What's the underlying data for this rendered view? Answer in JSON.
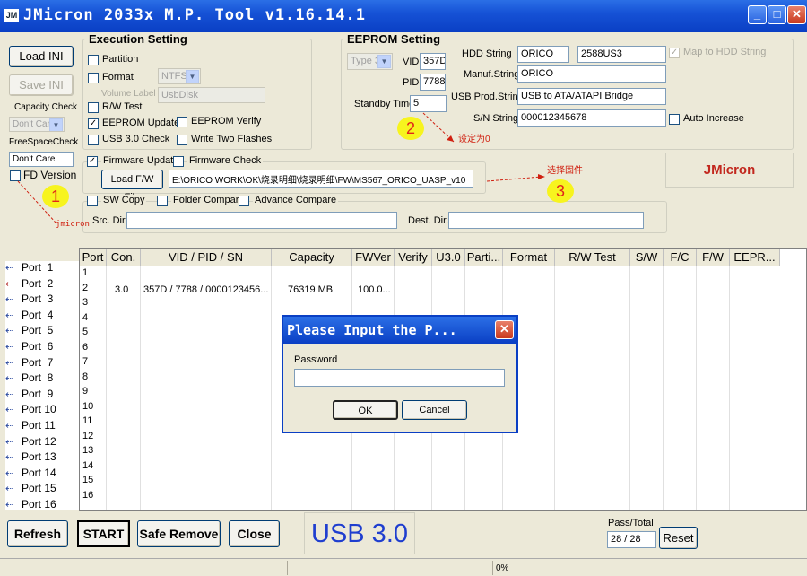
{
  "window": {
    "title": "JMicron 2033x M.P. Tool v1.16.14.1",
    "icon_label": "JM"
  },
  "left": {
    "load_ini": "Load INI",
    "save_ini": "Save INI",
    "capacity_check_label": "Capacity Check",
    "capacity_check_value": "Don't Care",
    "freespace_check_label": "FreeSpaceCheck",
    "freespace_check_value": "Don't Care",
    "fd_version": "FD Version"
  },
  "execution": {
    "title": "Execution Setting",
    "partition": "Partition",
    "format": "Format",
    "format_value": "NTFS",
    "volume_label": "Volume Label",
    "volume_value": "UsbDisk",
    "rw_test": "R/W Test",
    "eeprom_update": "EEPROM Update",
    "eeprom_verify": "EEPROM Verify",
    "usb30_check": "USB 3.0 Check",
    "write_two_flashes": "Write Two Flashes"
  },
  "eeprom": {
    "title": "EEPROM Setting",
    "type_value": "Type 3",
    "vid_label": "VID",
    "vid": "357D",
    "pid_label": "PID",
    "pid": "7788",
    "standby_label": "Standby Timer",
    "standby": "5",
    "hdd_string_label": "HDD String",
    "hdd_string_1": "ORICO",
    "hdd_string_2": "2588US3",
    "map_hdd": "Map to HDD String",
    "manuf_label": "Manuf.String",
    "manuf": "ORICO",
    "usbprod_label": "USB Prod.String",
    "usbprod": "USB to ATA/ATAPI Bridge",
    "sn_label": "S/N String",
    "sn": "000012345678",
    "auto_increase": "Auto Increase"
  },
  "brand": "JMicron",
  "firmware": {
    "update": "Firmware Update",
    "check": "Firmware Check",
    "load_btn": "Load F/W File",
    "path": "E:\\ORICO WORK\\OK\\烧录明细\\烧录明细\\FW\\MS567_ORICO_UASP_v10"
  },
  "compare": {
    "sw_copy": "SW Copy",
    "folder_compare": "Folder Compare",
    "advance_compare": "Advance Compare",
    "src_dir": "Src. Dir.",
    "dest_dir": "Dest. Dir."
  },
  "grid": {
    "columns": [
      "Port",
      "Con.",
      "VID / PID / SN",
      "Capacity",
      "FWVer",
      "Verify",
      "U3.0",
      "Parti...",
      "Format",
      "R/W Test",
      "S/W",
      "F/C",
      "F/W",
      "EEPR..."
    ],
    "rows": [
      "1",
      "2",
      "3",
      "4",
      "5",
      "6",
      "7",
      "8",
      "9",
      "10",
      "11",
      "12",
      "13",
      "14",
      "15",
      "16"
    ],
    "row2": {
      "con": "3.0",
      "vidpid": "357D / 7788 / 0000123456...",
      "capacity": "76319 MB",
      "fw": "100.0..."
    }
  },
  "ports": [
    "Port  1",
    "Port  2",
    "Port  3",
    "Port  4",
    "Port  5",
    "Port  6",
    "Port  7",
    "Port  8",
    "Port  9",
    "Port 10",
    "Port 11",
    "Port 12",
    "Port 13",
    "Port 14",
    "Port 15",
    "Port 16"
  ],
  "annotations": {
    "n1": "1",
    "n2": "2",
    "n3": "3",
    "t1": "jmicron",
    "t2": "设定为0",
    "t3": "选择固件"
  },
  "dialog": {
    "title": "Please Input the P...",
    "password_label": "Password",
    "ok": "OK",
    "cancel": "Cancel"
  },
  "bottom": {
    "refresh": "Refresh",
    "start": "START",
    "safe_remove": "Safe Remove",
    "close": "Close",
    "usb_label": "USB 3.0",
    "pass_total_label": "Pass/Total",
    "pass_total": "28 / 28",
    "reset": "Reset"
  },
  "status": {
    "progress": "0%"
  },
  "colors": {
    "title_blue": "#0a3fc4",
    "usb_blue": "#1f3ecf",
    "brand_red": "#c2281e",
    "annotation_yellow": "#f7f41e"
  }
}
